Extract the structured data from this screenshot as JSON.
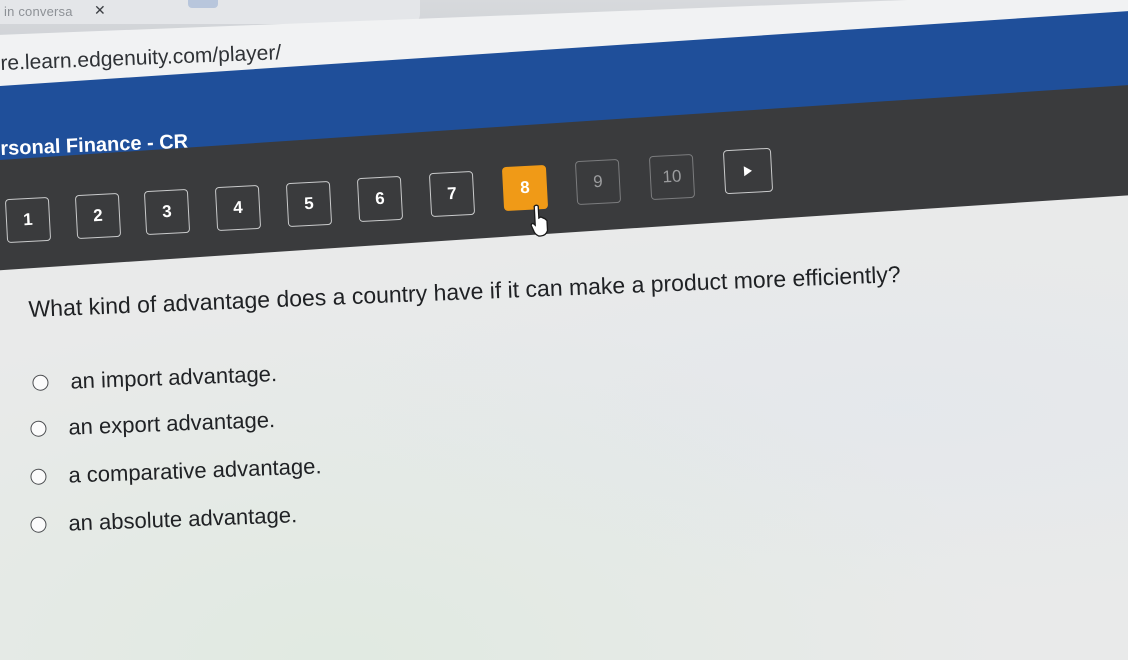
{
  "browser": {
    "tab_title": "in conversa",
    "tab_close": "✕",
    "url": "re.learn.edgenuity.com/player/"
  },
  "course": {
    "title": "rsonal Finance - CR"
  },
  "question_nav": {
    "items": [
      {
        "label": "1",
        "state": "visited"
      },
      {
        "label": "2",
        "state": "visited"
      },
      {
        "label": "3",
        "state": "visited"
      },
      {
        "label": "4",
        "state": "visited"
      },
      {
        "label": "5",
        "state": "visited"
      },
      {
        "label": "6",
        "state": "visited"
      },
      {
        "label": "7",
        "state": "visited"
      },
      {
        "label": "8",
        "state": "current"
      },
      {
        "label": "9",
        "state": "unvisited"
      },
      {
        "label": "10",
        "state": "unvisited"
      }
    ],
    "next_icon": "play-icon"
  },
  "question": {
    "text": "What kind of advantage does a country have if it can make a product more efficiently?",
    "options": [
      "an import advantage.",
      "an export advantage.",
      "a comparative advantage.",
      "an absolute advantage."
    ]
  },
  "colors": {
    "course_header": "#1f4f9a",
    "nav_band": "#3a3b3d",
    "current_question": "#f09a17"
  }
}
